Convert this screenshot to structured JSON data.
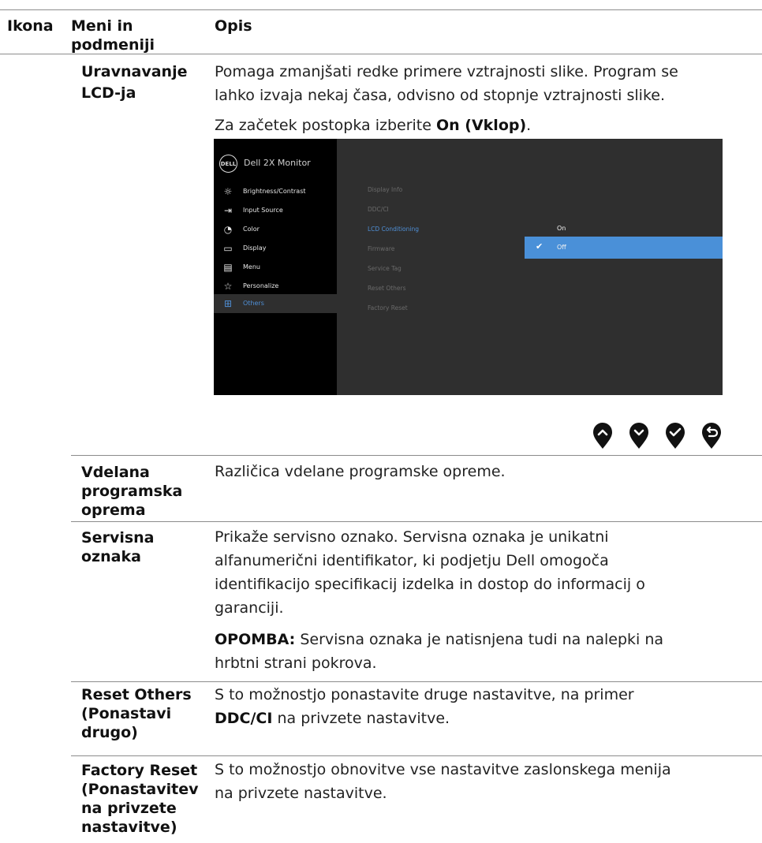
{
  "header": {
    "col_icon": "Ikona",
    "col_menu_line1": "Meni in",
    "col_menu_line2": "podmeniji",
    "col_desc": "Opis"
  },
  "rows": {
    "lcd": {
      "menu_line1": "Uravnavanje",
      "menu_line2": "LCD-ja",
      "desc_line1": "Pomaga zmanjšati redke primere vztrajnosti slike. Program se",
      "desc_line2": "lahko izvaja nekaj časa, odvisno od stopnje vztrajnosti slike.",
      "instr_prefix": "Za začetek postopka izberite ",
      "instr_bold": "On (Vklop)",
      "instr_suffix": "."
    },
    "firmware": {
      "menu": [
        "Vdelana",
        "programska",
        "oprema"
      ],
      "desc": "Različica vdelane programske opreme."
    },
    "service_tag": {
      "menu": [
        "Servisna",
        "oznaka"
      ],
      "desc": [
        "Prikaže servisno oznako. Servisna oznaka je unikatni",
        "alfanumerični identifikator, ki podjetju Dell omogoča",
        "identifikacijo specifikacij izdelka in dostop do informacij o",
        "garanciji."
      ],
      "note_bold": "OPOMBA:",
      "note_line1": " Servisna oznaka je natisnjena tudi na nalepki na",
      "note_line2": "hrbtni strani pokrova."
    },
    "reset_others": {
      "menu": [
        "Reset Others",
        "(Ponastavi",
        "drugo)"
      ],
      "desc_line1": "S to možnostjo ponastavite druge nastavitve, na primer",
      "desc_bold": "DDC/CI",
      "desc_line2_suffix": " na privzete nastavitve."
    },
    "factory_reset": {
      "menu": [
        "Factory Reset",
        "(Ponastavitev",
        "na privzete",
        "nastavitve)"
      ],
      "desc_line1": "S to možnostjo obnovitve vse nastavitve zaslonskega menija",
      "desc_line2": "na privzete nastavitve."
    }
  },
  "osd": {
    "logo": "DELL",
    "title": "Dell 2X Monitor",
    "menu_items": [
      {
        "label": "Brightness/Contrast",
        "icon": "sun-icon"
      },
      {
        "label": "Input Source",
        "icon": "input-icon"
      },
      {
        "label": "Color",
        "icon": "palette-icon"
      },
      {
        "label": "Display",
        "icon": "monitor-icon"
      },
      {
        "label": "Menu",
        "icon": "menu-icon"
      },
      {
        "label": "Personalize",
        "icon": "star-icon"
      },
      {
        "label": "Others",
        "icon": "sliders-icon",
        "selected": true
      }
    ],
    "submenu": [
      "Display Info",
      "DDC/CI",
      "LCD Conditioning",
      "Firmware",
      "Service Tag",
      "Reset Others",
      "Factory Reset"
    ],
    "options": [
      {
        "label": "On",
        "selected": false
      },
      {
        "label": "Off",
        "selected": true
      }
    ],
    "selected_color": "#4a90d8"
  },
  "nav_buttons": [
    "up-button-icon",
    "down-button-icon",
    "check-button-icon",
    "back-button-icon"
  ]
}
